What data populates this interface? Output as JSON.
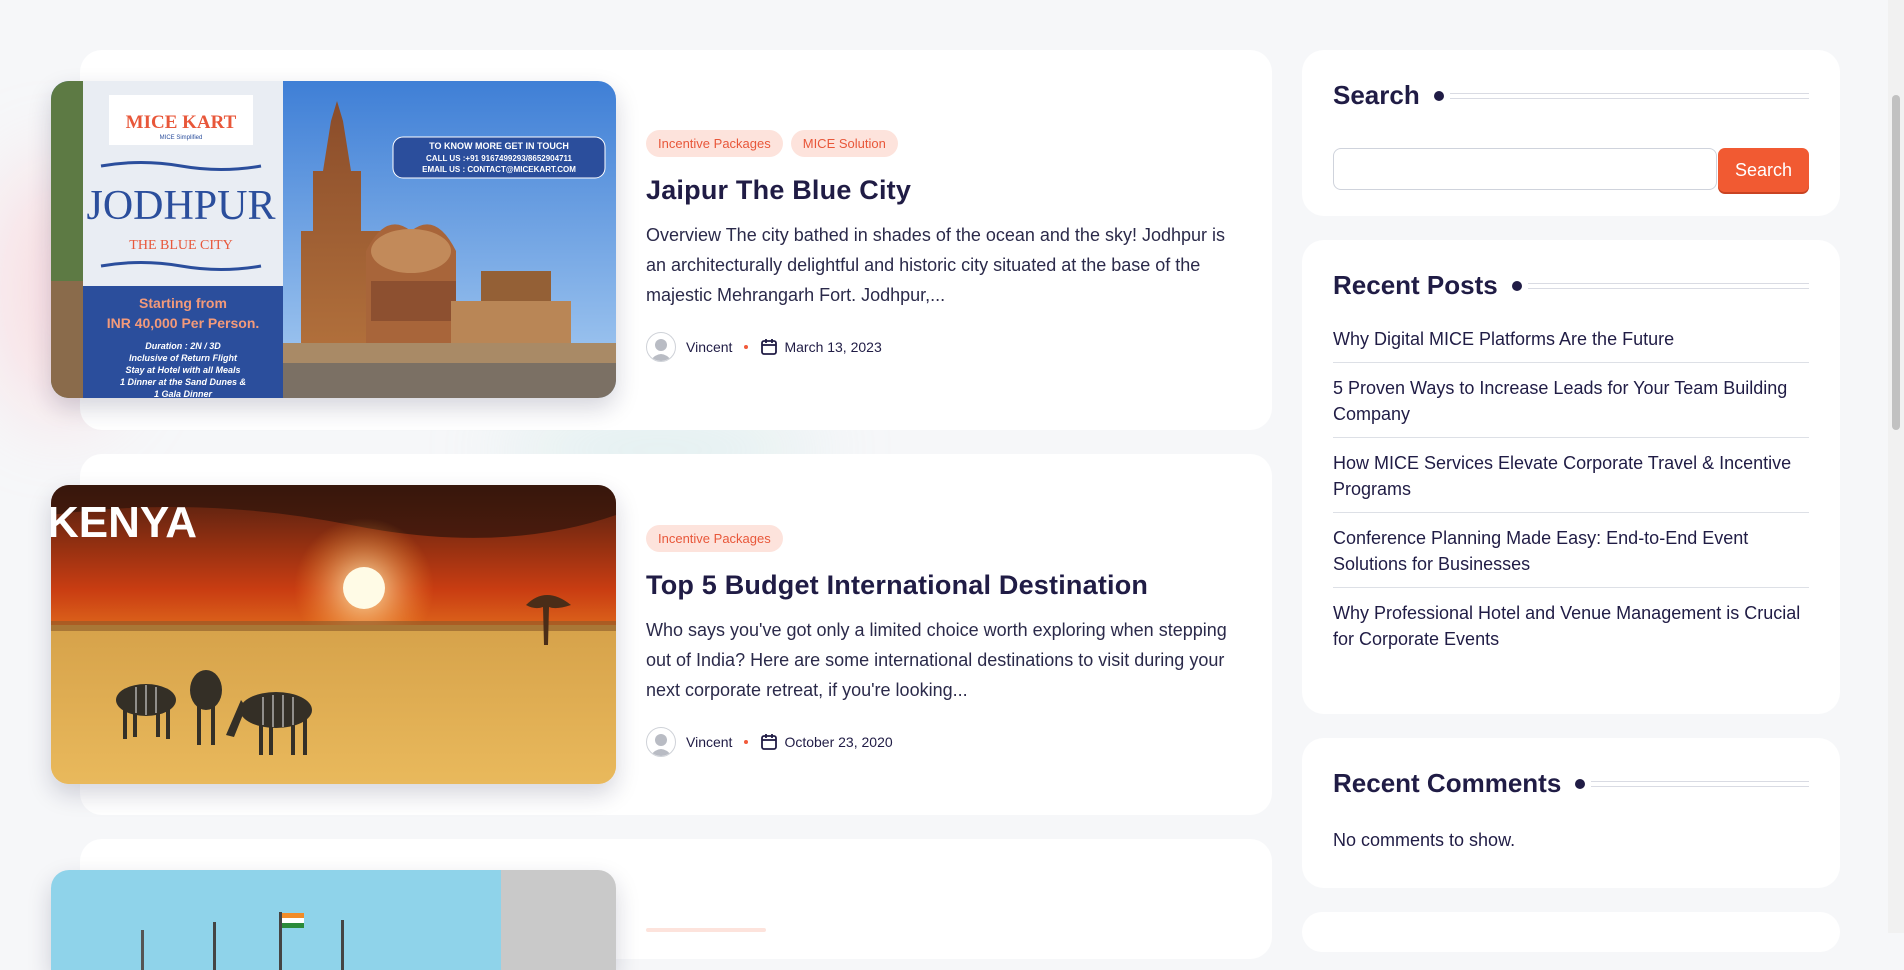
{
  "posts": [
    {
      "tags": [
        "Incentive Packages",
        "MICE Solution"
      ],
      "title": "Jaipur The Blue City",
      "excerpt": "Overview The city bathed in shades of the ocean and the sky! Jodhpur is an architecturally delightful and historic city situated at the base of the majestic Mehrangarh Fort. Jodhpur,...",
      "author": "Vincent",
      "date": "March 13, 2023",
      "image": {
        "brand": "MICE KART",
        "brand_sub": "MICE Simplified",
        "city": "JODHPUR",
        "subtitle": "THE BLUE CITY",
        "price_line1": "Starting from",
        "price_line2": "INR 40,000 Per Person.",
        "details": [
          "Duration : 2N / 3D",
          "Inclusive of Return Flight",
          "Stay at Hotel with all Meals",
          "1 Dinner at the Sand Dunes &",
          "1 Gala Dinner"
        ],
        "contact": [
          "TO KNOW MORE GET IN TOUCH",
          "CALL US :+91 9167499293/8652904711",
          "EMAIL US : CONTACT@MICEKART.COM"
        ]
      }
    },
    {
      "tags": [
        "Incentive Packages"
      ],
      "title": "Top 5 Budget International Destination",
      "excerpt": "Who says you've got only a limited choice worth exploring when stepping out of India? Here are some international destinations to visit during your next corporate retreat, if you're looking...",
      "author": "Vincent",
      "date": "October 23, 2020",
      "image": {
        "caption": "KENYA"
      }
    }
  ],
  "sidebar": {
    "search": {
      "title": "Search",
      "button": "Search",
      "placeholder": ""
    },
    "recent_posts": {
      "title": "Recent Posts",
      "items": [
        "Why Digital MICE Platforms Are the Future",
        "5 Proven Ways to Increase Leads for Your Team Building Company",
        "How MICE Services Elevate Corporate Travel & Incentive Programs",
        "Conference Planning Made Easy: End-to-End Event Solutions for Businesses",
        "Why Professional Hotel and Venue Management is Crucial for Corporate Events"
      ]
    },
    "recent_comments": {
      "title": "Recent Comments",
      "empty": "No comments to show."
    }
  },
  "colors": {
    "accent": "#f15a32",
    "tag_bg": "#fde3dc",
    "heading": "#201c45"
  },
  "icons": {
    "author": "user-avatar-icon",
    "date": "calendar-icon"
  }
}
